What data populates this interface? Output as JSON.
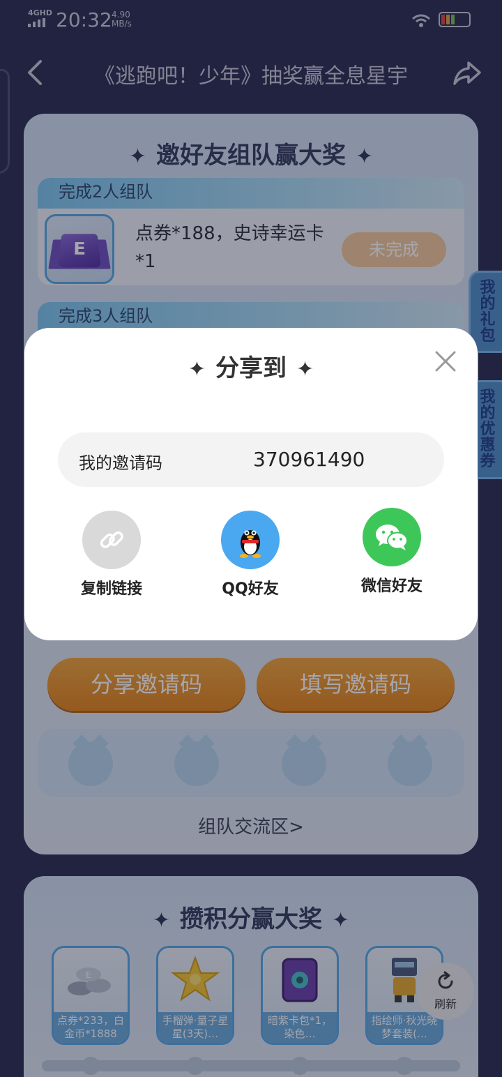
{
  "status_bar": {
    "network": "4GHD",
    "time": "20:32",
    "speed_value": "4.90",
    "speed_unit": "MB/s"
  },
  "nav": {
    "title": "《逃跑吧！少年》抽奖赢全息星宇"
  },
  "team_card": {
    "title": "邀好友组队赢大奖",
    "tier1": {
      "header": "完成2人组队",
      "reward": "点券*188，史诗幸运卡*1",
      "status": "未完成"
    },
    "tier2": {
      "header": "完成3人组队"
    },
    "share_code_button": "分享邀请码",
    "fill_code_button": "填写邀请码",
    "team_exchange_link": "组队交流区>"
  },
  "points_card": {
    "title": "攒积分赢大奖",
    "prizes": [
      {
        "label": "点券*233，白金币*1888"
      },
      {
        "label": "手榴弹·量子星星(3天)…"
      },
      {
        "label": "暗紫卡包*1，染色…"
      },
      {
        "label": "指绘师·秋光晓梦套装(…"
      }
    ]
  },
  "side_tabs": {
    "gift": "我的礼包",
    "coupon": "我的优惠券"
  },
  "refresh_label": "刷新",
  "share_dialog": {
    "title": "分享到",
    "invite_label": "我的邀请码",
    "invite_code": "370961490",
    "options": {
      "copy": "复制链接",
      "qq": "QQ好友",
      "wechat": "微信好友"
    }
  },
  "colors": {
    "background": "#2b2c52",
    "accent_orange": "#e88d20",
    "qq_blue": "#4aa8f0",
    "wechat_green": "#3ec759",
    "copy_gray": "#d9d9d9"
  }
}
